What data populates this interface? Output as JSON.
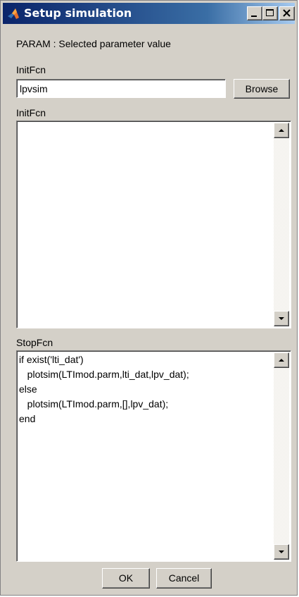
{
  "window": {
    "title": "Setup simulation",
    "controls": [
      "minimize-icon",
      "maximize-icon",
      "close-icon"
    ]
  },
  "param_label": "PARAM :  Selected parameter value",
  "init_field": {
    "label": "InitFcn",
    "value": "lpvsim",
    "browse_label": "Browse"
  },
  "init_code": {
    "label": "InitFcn",
    "lines": []
  },
  "stop_code": {
    "label": "StopFcn",
    "lines": [
      "if exist('lti_dat')",
      "   plotsim(LTImod.parm,lti_dat,lpv_dat);",
      "else",
      "   plotsim(LTImod.parm,[],lpv_dat);",
      "end"
    ]
  },
  "footer": {
    "ok_label": "OK",
    "cancel_label": "Cancel"
  },
  "colors": {
    "title_gradient_start": "#0a246a",
    "title_gradient_end": "#a6caf0",
    "dialog_face": "#d4d0c8"
  }
}
